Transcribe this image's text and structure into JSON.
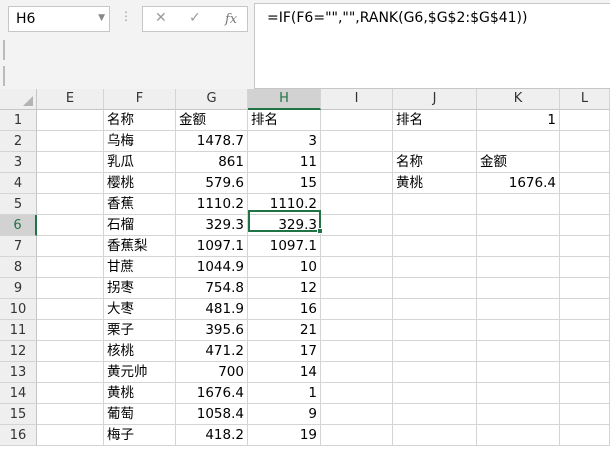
{
  "name_box": "H6",
  "formula": "=IF(F6=\"\",\"\",RANK(G6,$G$2:$G$41))",
  "columns": [
    "E",
    "F",
    "G",
    "H",
    "I",
    "J",
    "K",
    "L"
  ],
  "rows": [
    "1",
    "2",
    "3",
    "4",
    "5",
    "6",
    "7",
    "8",
    "9",
    "10",
    "11",
    "12",
    "13",
    "14",
    "15",
    "16"
  ],
  "table": [
    {
      "F": "名称",
      "G": "金额",
      "H": "排名"
    },
    {
      "F": "乌梅",
      "G": "1478.7",
      "H": "3"
    },
    {
      "F": "乳瓜",
      "G": "861",
      "H": "11"
    },
    {
      "F": "樱桃",
      "G": "579.6",
      "H": "15"
    },
    {
      "F": "香蕉",
      "G": "1110.2",
      "H": "1110.2"
    },
    {
      "F": "石榴",
      "G": "329.3",
      "H": "329.3"
    },
    {
      "F": "香蕉梨",
      "G": "1097.1",
      "H": "1097.1"
    },
    {
      "F": "甘蔗",
      "G": "1044.9",
      "H": "10"
    },
    {
      "F": "拐枣",
      "G": "754.8",
      "H": "12"
    },
    {
      "F": "大枣",
      "G": "481.9",
      "H": "16"
    },
    {
      "F": "栗子",
      "G": "395.6",
      "H": "21"
    },
    {
      "F": "核桃",
      "G": "471.2",
      "H": "17"
    },
    {
      "F": "黄元帅",
      "G": "700",
      "H": "14"
    },
    {
      "F": "黄桃",
      "G": "1676.4",
      "H": "1"
    },
    {
      "F": "葡萄",
      "G": "1058.4",
      "H": "9"
    },
    {
      "F": "梅子",
      "G": "418.2",
      "H": "19"
    }
  ],
  "lookup": {
    "rank_label": "排名",
    "rank_value": "1",
    "name_label": "名称",
    "amount_label": "金额",
    "name_value": "黄桃",
    "amount_value": "1676.4"
  }
}
